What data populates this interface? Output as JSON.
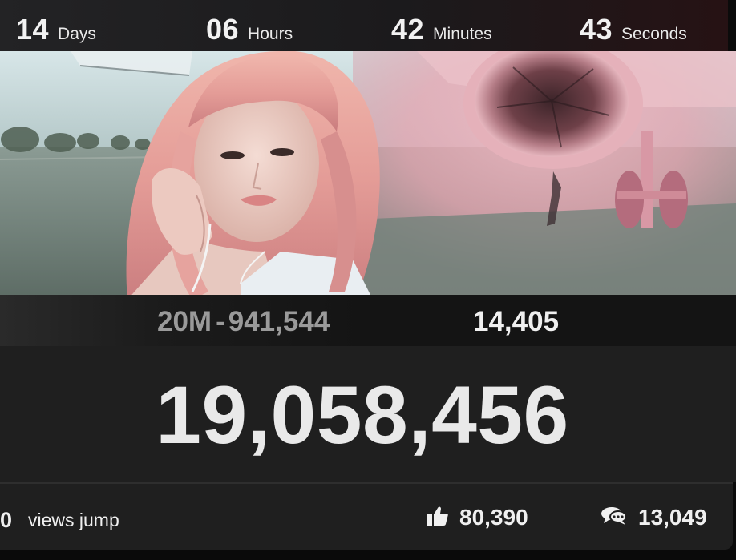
{
  "countdown": {
    "days": {
      "value": "14",
      "label": "Days"
    },
    "hours": {
      "value": "06",
      "label": "Hours"
    },
    "minutes": {
      "value": "42",
      "label": "Minutes"
    },
    "seconds": {
      "value": "43",
      "label": "Seconds"
    }
  },
  "stats": {
    "goal": "20M",
    "separator": "-",
    "remaining": "941,544",
    "gain": "14,405"
  },
  "counter": {
    "views": "19,058,456"
  },
  "footer": {
    "jump_value": "0",
    "jump_label": "views jump",
    "likes": "80,390",
    "comments": "13,049"
  },
  "colors": {
    "accent_pink": "#e8a3ab",
    "background": "#1f1f1f"
  },
  "icons": {
    "likes": "thumbs-up-icon",
    "comments": "speech-bubbles-icon"
  }
}
